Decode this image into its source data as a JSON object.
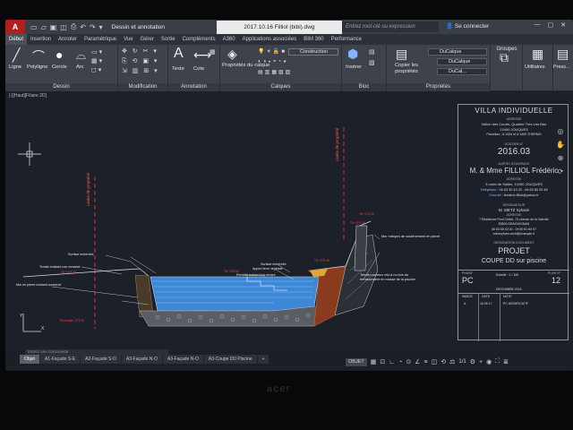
{
  "titlebar": {
    "app_logo": "A",
    "workspace": "Dessin et annotation",
    "document_title": "2017.10.16 Filliol (bibi).dwg",
    "search_placeholder": "Entrez mot-clé ou expression",
    "sign_in": "Se connecter",
    "icons": [
      "new-icon",
      "open-icon",
      "save-icon",
      "saveas-icon",
      "print-icon",
      "undo-icon",
      "redo-icon",
      "share-icon"
    ]
  },
  "ribbon_tabs": [
    "Début",
    "Insertion",
    "Annoter",
    "Paramétrique",
    "Vue",
    "Gérer",
    "Sortie",
    "Compléments",
    "A360",
    "Applications associées",
    "BIM 360",
    "Performance"
  ],
  "ribbon": {
    "dessin": {
      "title": "Dessin",
      "line": "Ligne",
      "polyline": "Polyligne",
      "circle": "Cercle",
      "arc": "Arc"
    },
    "modification": {
      "title": "Modification"
    },
    "annotation": {
      "title": "Annotation",
      "text": "Texte",
      "dimension": "Cote"
    },
    "calques": {
      "title": "Calques",
      "properties": "Propriétés du calque",
      "layer_name": "Construction"
    },
    "bloc": {
      "title": "Bloc",
      "insert": "Insérer"
    },
    "proprietes": {
      "title": "Propriétés",
      "copy": "Copier les propriétés",
      "color": "DuCalque",
      "linetype": "DuCalque",
      "lineweight": "DuCal..."
    },
    "groups": "Groupes",
    "utilities": "Utilitaires",
    "clipboard": "Press..."
  },
  "view_label": "[-][Haut][Filaire 2D]",
  "drawing_labels": {
    "limit_left": "Limite de propriété",
    "limit_right": "Limite de propriété",
    "surface_enherbee": "Surface enherbée",
    "terrain_non_remanie": "Terrain existant non remanié",
    "mur_pierre": "Mur en pierre existant conservé",
    "piscine_label": "Surface enherbée",
    "apport_terre": "Apport terre végétale",
    "remblai": "Remblai ballast tout-venant",
    "mur_moyen": "Mur mitoyen de soutènement en pierre",
    "terrain_rocheux": "Terrain rocheux mis à nu lors du terrassement en masse de la piscine"
  },
  "title_block": {
    "project_type": "VILLA INDIVIDUELLE",
    "address_label": "ADRESSE",
    "address": "Vallon des Courts, Quartier Trés Les Bas",
    "city": "13490 JOUQUES",
    "parcel": "Parcelles : A 1404 et A 1405 THERMO",
    "dossier_label": "DOSSIER N°",
    "dossier_number": "2016.03",
    "client_label": "MAÎTRE D'OUVRAGE",
    "client": "M. & Mme FILLIOL Frédéric",
    "client_address_label": "ADRESSE",
    "client_address": "3 route de Saliès, 13490 JOUQUES",
    "phone_label": "Téléphone",
    "phone": "06 63 30 43 30 - 06 63 65 05 45",
    "email_label": "Courriel",
    "email": "frederic.filliol@yahoo.fr",
    "designer_label": "DESSINATEUR",
    "designer": "M. METZ Sylvain",
    "designer_address_label": "ADRESSE",
    "designer_address": "7 Résidence Pont Crétet, 73 chemin de la Gairolle",
    "designer_city": "83500 DRAGUIGNAN",
    "designer_phone": "06 83 58 42 00 - 09 50 81 80 97",
    "designer_email": "metzsylvain.archi@example.fr",
    "designation_label": "DESIGNATION  DOCUMENT",
    "document_type": "PROJET",
    "document_title": "COUPE  DD sur piscine",
    "phase_label": "PHASE",
    "phase": "PC",
    "scale_label": "Echelle : 1 / 100",
    "plan_label": "PLAN  N°",
    "plan_number": "12",
    "date_label": "DECEMBRE 2016",
    "rev_headers": [
      "INDICE",
      "DATE",
      "NOTE"
    ],
    "rev_row": [
      "A",
      "16.05.17",
      "PC MODIFICATIF"
    ]
  },
  "layout_tabs": [
    "Objet",
    "A1-Façade S-E",
    "A2-Façade S-O",
    "A3-Façade N-O",
    "A3-Façade N-O",
    "A3-Coupe DD Piscine"
  ],
  "command_line": "Entrez une commande",
  "status": {
    "mode": "OBJET",
    "scale": "1/1"
  }
}
